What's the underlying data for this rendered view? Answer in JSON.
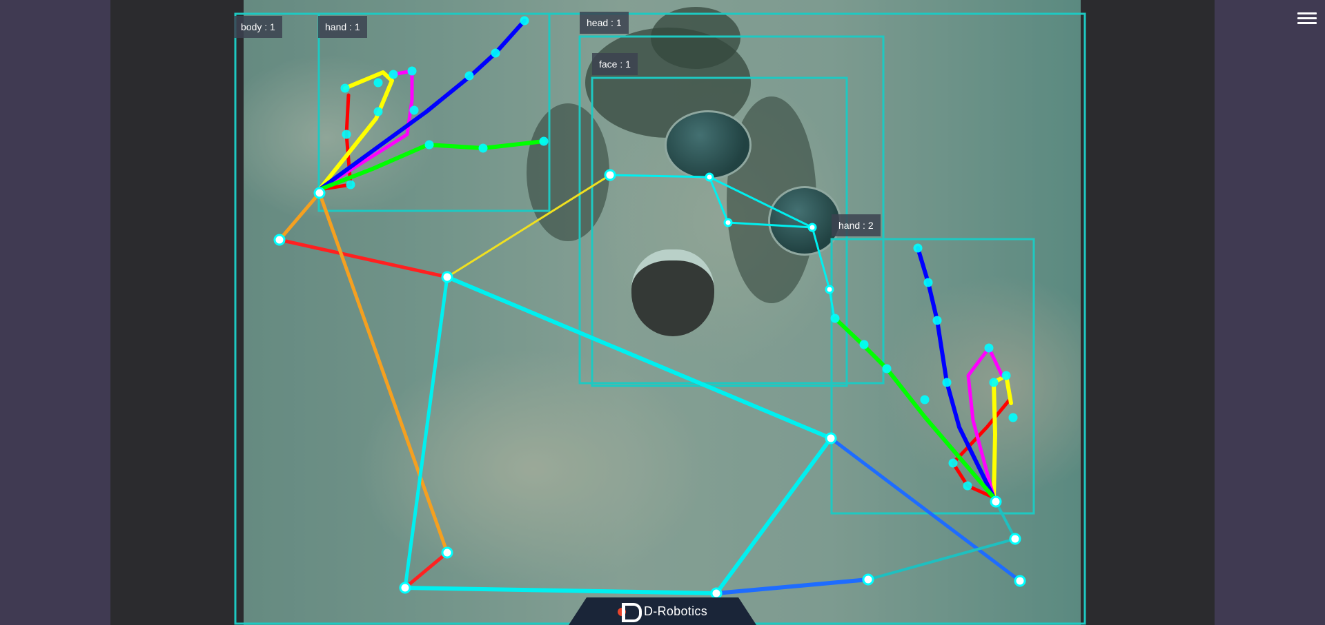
{
  "app": {
    "brand_name": "D-Robotics",
    "menu_icon": "hamburger-menu-icon"
  },
  "detections": [
    {
      "label": "body : 1",
      "color": "#1ec9c2"
    },
    {
      "label": "hand : 1",
      "color": "#1ec9c2"
    },
    {
      "label": "head : 1",
      "color": "#1ec9c2"
    },
    {
      "label": "face : 1",
      "color": "#1ec9c2"
    },
    {
      "label": "hand : 2",
      "color": "#1ec9c2"
    }
  ],
  "colors": {
    "box_outline": "#1ec9c2",
    "keypoint_fill": "#ffffff",
    "keypoint_ring": "#00ffff",
    "limb_cyan": "#00f0f0",
    "limb_red": "#ff2020",
    "limb_orange": "#f5a020",
    "limb_yellow": "#f0e020",
    "limb_blue": "#1e6cff",
    "limb_teal": "#1ec0c0",
    "finger_thumb": "#ff0000",
    "finger_index": "#ffff00",
    "finger_middle": "#ff00ff",
    "finger_ring": "#0000ff",
    "finger_pinky": "#00ff00",
    "brand_accent": "#e9452c",
    "brand_tab": "#1a2538"
  }
}
